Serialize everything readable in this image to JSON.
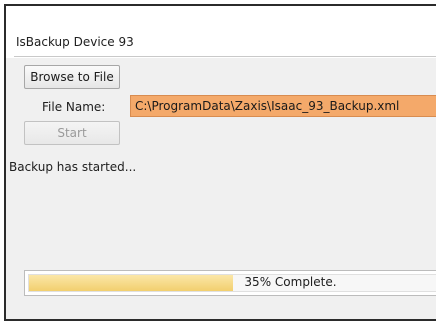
{
  "window": {
    "title": "IsBackup Device 93"
  },
  "buttons": {
    "browse_label": "Browse to File",
    "start_label": "Start"
  },
  "file": {
    "label": "File Name:",
    "value": "C:\\ProgramData\\Zaxis\\Isaac_93_Backup.xml"
  },
  "status": {
    "message": "Backup has started..."
  },
  "progress": {
    "fraction": 0.5,
    "text": "35% Complete."
  },
  "colors": {
    "field_highlight": "#f4a96a",
    "progress_fill": "#f2cf6e"
  }
}
